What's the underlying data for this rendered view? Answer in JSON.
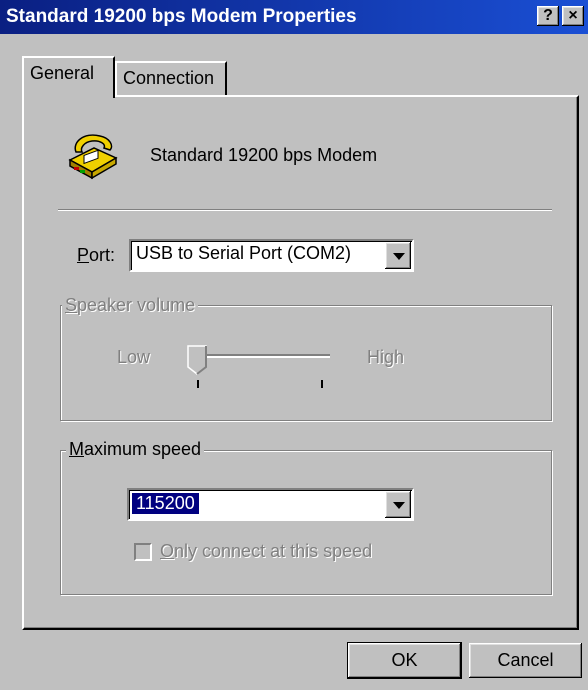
{
  "window": {
    "title": "Standard 19200 bps Modem Properties",
    "help_button": "?",
    "close_button": "×"
  },
  "tabs": [
    {
      "label": "General",
      "active": true
    },
    {
      "label": "Connection",
      "active": false
    }
  ],
  "general": {
    "modem_name": "Standard 19200 bps Modem",
    "modem_icon": "modem-telephone-icon",
    "port": {
      "label_accel": "P",
      "label_rest": "ort:",
      "value": "USB to Serial Port (COM2)"
    },
    "speaker_volume": {
      "legend_accel": "S",
      "legend_rest": "peaker volume",
      "low_label": "Low",
      "high_label": "High",
      "level": 0,
      "enabled": false
    },
    "maximum_speed": {
      "legend_accel": "M",
      "legend_rest": "aximum speed",
      "value": "115200",
      "only_connect_accel": "O",
      "only_connect_rest": "nly connect at this speed",
      "only_connect_checked": false,
      "only_connect_enabled": false
    }
  },
  "buttons": {
    "ok": "OK",
    "cancel": "Cancel"
  },
  "colors": {
    "title_gradient_start": "#0a1f82",
    "title_gradient_end": "#1a4fd4",
    "selection": "#000080",
    "face": "#c0c0c0"
  }
}
